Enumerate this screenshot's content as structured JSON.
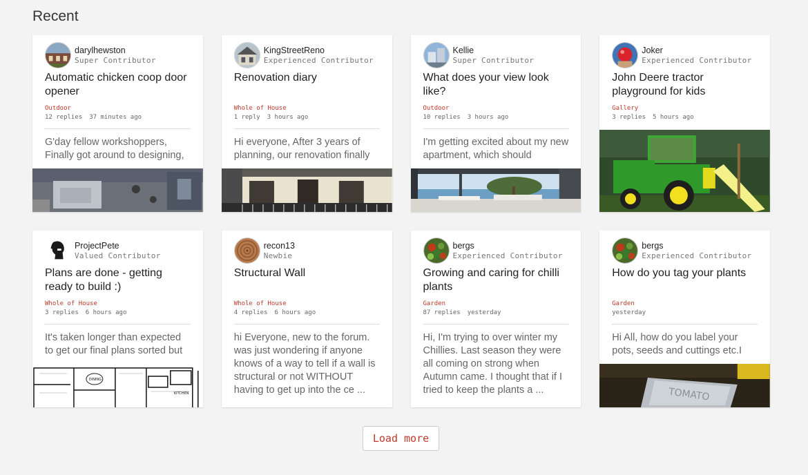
{
  "section": {
    "title": "Recent"
  },
  "cards": [
    {
      "author": "darylhewston",
      "rank": "Super Contributor",
      "avatar_icon": "house-photo-icon",
      "title": "Automatic chicken coop door opener",
      "board": "Outdoor",
      "replies": "12 replies",
      "time": "37 minutes ago",
      "excerpt": "G'day fellow workshoppers, Finally got around to designing,",
      "thumbnail": "workbench-photo"
    },
    {
      "author": "KingStreetReno",
      "rank": "Experienced Contributor",
      "avatar_icon": "house-photo-icon",
      "title": "Renovation diary",
      "board": "Whole of House",
      "replies": "1 reply",
      "time": "3 hours ago",
      "excerpt": "Hi everyone, After 3 years of planning, our renovation finally",
      "thumbnail": "terrace-house-photo"
    },
    {
      "author": "Kellie",
      "rank": "Super Contributor",
      "avatar_icon": "building-photo-icon",
      "title": "What does your view look like?",
      "board": "Outdoor",
      "replies": "10 replies",
      "time": "3 hours ago",
      "excerpt": "I'm getting excited about my new apartment, which should",
      "thumbnail": "ocean-view-photo"
    },
    {
      "author": "Joker",
      "rank": "Experienced Contributor",
      "avatar_icon": "red-ball-icon",
      "title": "John Deere tractor playground for kids",
      "board": "Gallery",
      "replies": "3 replies",
      "time": "5 hours ago",
      "excerpt": "",
      "thumbnail": "tractor-playground-photo"
    },
    {
      "author": "ProjectPete",
      "rank": "Valued Contributor",
      "avatar_icon": "person-silhouette-icon",
      "title": "Plans are done - getting ready to build :)",
      "board": "Whole of House",
      "replies": "3 replies",
      "time": "6 hours ago",
      "excerpt": "It's taken longer than expected to get our final plans sorted but",
      "thumbnail": "floor-plan-image",
      "plan_labels": [
        "DINING",
        "KITCHEN"
      ]
    },
    {
      "author": "recon13",
      "rank": "Newbie",
      "avatar_icon": "wood-slice-icon",
      "title": "Structural Wall",
      "board": "Whole of House",
      "replies": "4 replies",
      "time": "6 hours ago",
      "excerpt": "hi Everyone, new to the forum. was just wondering if anyone knows of a way to tell if a wall is structural or not WITHOUT having to get up into the ce ...",
      "thumbnail": ""
    },
    {
      "author": "bergs",
      "rank": "Experienced Contributor",
      "avatar_icon": "chilli-plant-icon",
      "title": "Growing and caring for chilli plants",
      "board": "Garden",
      "replies": "87 replies",
      "time": "yesterday",
      "excerpt": "Hi, I'm trying to over winter my Chillies. Last season they were all coming on strong when Autumn came. I thought that if I tried to keep the plants a ...",
      "thumbnail": ""
    },
    {
      "author": "bergs",
      "rank": "Experienced Contributor",
      "avatar_icon": "chilli-plant-icon",
      "title": "How do you tag your plants",
      "board": "Garden",
      "replies": "",
      "time": "yesterday",
      "excerpt": "Hi All, how do you label your pots, seeds and cuttings etc.I",
      "thumbnail": "plant-tag-photo",
      "tag_text": "TOMATO"
    }
  ],
  "load_more": {
    "label": "Load more"
  },
  "colors": {
    "accent": "#c0392b",
    "background": "#f3f3f3",
    "card": "#ffffff"
  }
}
